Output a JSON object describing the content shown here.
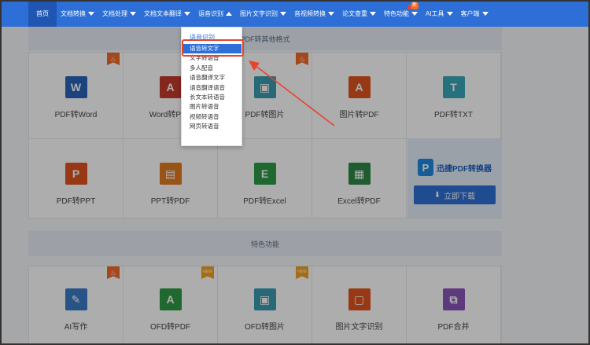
{
  "nav": {
    "items": [
      {
        "label": "首页",
        "arrow": false
      },
      {
        "label": "文档转换",
        "arrow": true
      },
      {
        "label": "文档处理",
        "arrow": true
      },
      {
        "label": "文档文本翻译",
        "arrow": true
      },
      {
        "label": "语音识别",
        "arrow": true
      },
      {
        "label": "图片文字识别",
        "arrow": true
      },
      {
        "label": "音视频转换",
        "arrow": true
      },
      {
        "label": "论文查重",
        "arrow": true
      },
      {
        "label": "特色功能",
        "arrow": true,
        "badge": "新"
      },
      {
        "label": "AI工具",
        "arrow": true
      },
      {
        "label": "客户端",
        "arrow": true
      }
    ]
  },
  "sections": {
    "top": "PDF转其他格式",
    "special": "特色功能"
  },
  "tiles_row1": [
    {
      "label": "PDF转Word",
      "icon": "word-icon",
      "glyph": "W",
      "color": "#2a64b8",
      "corner": "hot"
    },
    {
      "label": "Word转PDF",
      "icon": "pdf-icon",
      "glyph": "A",
      "color": "#c53a2c",
      "corner": ""
    },
    {
      "label": "PDF转图片",
      "icon": "image-icon",
      "glyph": "▣",
      "color": "#3a9bb0",
      "corner": "hot"
    },
    {
      "label": "图片转PDF",
      "icon": "pdf-icon",
      "glyph": "A",
      "color": "#e0551f",
      "corner": ""
    },
    {
      "label": "PDF转TXT",
      "icon": "txt-icon",
      "glyph": "T",
      "color": "#3aa6b8",
      "corner": ""
    }
  ],
  "tiles_row2": [
    {
      "label": "PDF转PPT",
      "icon": "ppt-icon",
      "glyph": "P",
      "color": "#e0551f"
    },
    {
      "label": "PPT转PDF",
      "icon": "ppt-pdf-icon",
      "glyph": "▤",
      "color": "#e07b1f"
    },
    {
      "label": "PDF转Excel",
      "icon": "excel-icon",
      "glyph": "E",
      "color": "#2e9a48"
    },
    {
      "label": "Excel转PDF",
      "icon": "excel-pdf-icon",
      "glyph": "▦",
      "color": "#2e8a48"
    }
  ],
  "promo": {
    "brand": "迅捷PDF转换器",
    "logo": "P",
    "button": "立即下载"
  },
  "tiles_row3": [
    {
      "label": "AI写作",
      "icon": "pen-icon",
      "glyph": "✎",
      "color": "#3a7bc8",
      "corner": "hot"
    },
    {
      "label": "OFD转PDF",
      "icon": "ofd-icon",
      "glyph": "A",
      "color": "#2e9a48",
      "corner": "new"
    },
    {
      "label": "OFD转图片",
      "icon": "image-icon",
      "glyph": "▣",
      "color": "#3a9bb0",
      "corner": "new"
    },
    {
      "label": "图片文字识别",
      "icon": "ocr-icon",
      "glyph": "▢",
      "color": "#e0551f",
      "corner": ""
    },
    {
      "label": "PDF合并",
      "icon": "merge-icon",
      "glyph": "⧉",
      "color": "#8a56b8",
      "corner": ""
    }
  ],
  "corner_labels": {
    "hot": "♨",
    "new": "NEW"
  },
  "dropdown": {
    "header": "语音识别",
    "items": [
      "语音转文字",
      "文字转语音",
      "多人配音",
      "语音翻译文字",
      "语音翻译语音",
      "长文本转语音",
      "图片转语音",
      "视频转语音",
      "网页转语音"
    ],
    "selected_index": 0
  },
  "colors": {
    "accent": "#2d6fd6",
    "highlight": "#e8432e"
  }
}
